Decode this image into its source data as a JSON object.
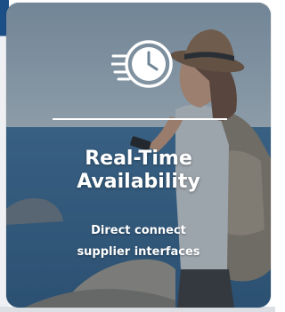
{
  "card": {
    "icon": "clock-speed-icon",
    "title": "Real-Time\nAvailability",
    "subtitle": "Direct connect\nsupplier interfaces"
  }
}
